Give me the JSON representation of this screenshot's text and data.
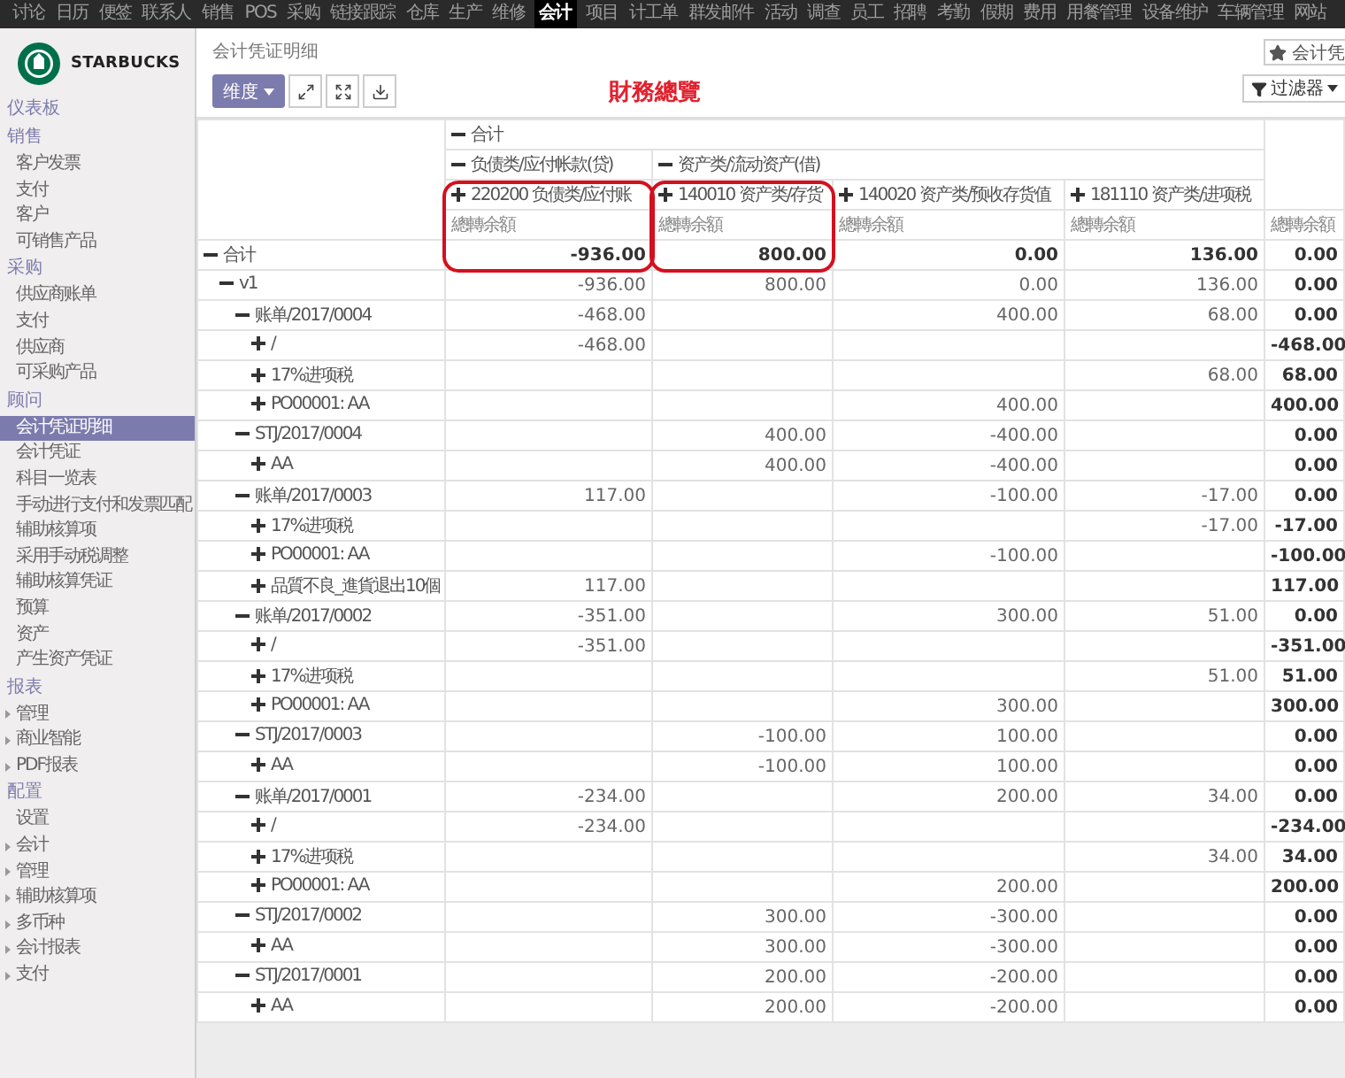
{
  "top_menu": [
    {
      "label": "讨论",
      "selected": false
    },
    {
      "label": "日历",
      "selected": false
    },
    {
      "label": "便签",
      "selected": false
    },
    {
      "label": "联系人",
      "selected": false
    },
    {
      "label": "销售",
      "selected": false
    },
    {
      "label": "POS",
      "selected": false
    },
    {
      "label": "采购",
      "selected": false
    },
    {
      "label": "链接跟踪",
      "selected": false
    },
    {
      "label": "仓库",
      "selected": false
    },
    {
      "label": "生产",
      "selected": false
    },
    {
      "label": "维修",
      "selected": false
    },
    {
      "label": "会计",
      "selected": true
    },
    {
      "label": "项目",
      "selected": false
    },
    {
      "label": "计工单",
      "selected": false
    },
    {
      "label": "群发邮件",
      "selected": false
    },
    {
      "label": "活动",
      "selected": false
    },
    {
      "label": "调查",
      "selected": false
    },
    {
      "label": "员工",
      "selected": false
    },
    {
      "label": "招聘",
      "selected": false
    },
    {
      "label": "考勤",
      "selected": false
    },
    {
      "label": "假期",
      "selected": false
    },
    {
      "label": "费用",
      "selected": false
    },
    {
      "label": "用餐管理",
      "selected": false
    },
    {
      "label": "设备维护",
      "selected": false
    },
    {
      "label": "车辆管理",
      "selected": false
    },
    {
      "label": "网站",
      "selected": false
    }
  ],
  "sidebar": {
    "logo_text": "STARBUCKS",
    "sections": [
      {
        "title": "仪表板"
      },
      {
        "title": "销售",
        "items": [
          {
            "label": "客户发票",
            "selected": false,
            "expandable": false
          },
          {
            "label": "支付",
            "selected": false,
            "expandable": false
          },
          {
            "label": "客户",
            "selected": false,
            "expandable": false
          },
          {
            "label": "可销售产品",
            "selected": false,
            "expandable": false
          }
        ]
      },
      {
        "title": "采购",
        "items": [
          {
            "label": "供应商账单",
            "selected": false,
            "expandable": false
          },
          {
            "label": "支付",
            "selected": false,
            "expandable": false
          },
          {
            "label": "供应商",
            "selected": false,
            "expandable": false
          },
          {
            "label": "可采购产品",
            "selected": false,
            "expandable": false
          }
        ]
      },
      {
        "title": "顾问",
        "items": [
          {
            "label": "会计凭证明细",
            "selected": true,
            "expandable": false
          },
          {
            "label": "会计凭证",
            "selected": false,
            "expandable": false
          },
          {
            "label": "科目一览表",
            "selected": false,
            "expandable": false
          },
          {
            "label": "手动进行支付和发票匹配",
            "selected": false,
            "expandable": false
          },
          {
            "label": "辅助核算项",
            "selected": false,
            "expandable": false
          },
          {
            "label": "采用手动税调整",
            "selected": false,
            "expandable": false
          },
          {
            "label": "辅助核算凭证",
            "selected": false,
            "expandable": false
          },
          {
            "label": "预算",
            "selected": false,
            "expandable": false
          },
          {
            "label": "资产",
            "selected": false,
            "expandable": false
          },
          {
            "label": "产生资产凭证",
            "selected": false,
            "expandable": false
          }
        ]
      },
      {
        "title": "报表",
        "items": [
          {
            "label": "管理",
            "selected": false,
            "expandable": true
          },
          {
            "label": "商业智能",
            "selected": false,
            "expandable": true
          },
          {
            "label": "PDF报表",
            "selected": false,
            "expandable": true
          }
        ]
      },
      {
        "title": "配置",
        "items": [
          {
            "label": "设置",
            "selected": false,
            "expandable": false
          },
          {
            "label": "会计",
            "selected": false,
            "expandable": true
          },
          {
            "label": "管理",
            "selected": false,
            "expandable": true
          },
          {
            "label": "辅助核算项",
            "selected": false,
            "expandable": true
          },
          {
            "label": "多币种",
            "selected": false,
            "expandable": true
          },
          {
            "label": "会计报表",
            "selected": false,
            "expandable": true
          },
          {
            "label": "支付",
            "selected": false,
            "expandable": true
          }
        ]
      }
    ]
  },
  "control_panel": {
    "breadcrumb": "会计凭证明细",
    "dimension_button": "维度",
    "annotation": "財務總覽",
    "favorite": "会计凭",
    "filter": "过滤器"
  },
  "pivot": {
    "total": {
      "label": "合计",
      "expanded": true
    },
    "groups": [
      {
        "label": "负债类/应付帐款(贷)",
        "expanded": true,
        "accounts": [
          {
            "label": "220200 负债类/应付账",
            "expanded": false,
            "circled": true
          }
        ]
      },
      {
        "label": "资产类/流动资产(借)",
        "expanded": true,
        "accounts": [
          {
            "label": "140010 资产类/存货",
            "expanded": false,
            "circled": true
          },
          {
            "label": "140020 资产类/预收存货值",
            "expanded": false,
            "circled": false
          },
          {
            "label": "181110 资产类/进项税",
            "expanded": false,
            "circled": false
          }
        ]
      }
    ],
    "measures": [
      "總轉余額",
      "總轉余額",
      "總轉余額",
      "總轉余額",
      "總轉余額"
    ],
    "rows": [
      {
        "label": "合计",
        "expanded": true,
        "values": {
          "col_1": "-936.00",
          "col_2": "800.00",
          "col_3": "0.00",
          "col_4": "136.00",
          "col_5": "0.00"
        },
        "children": [
          {
            "label": "v1",
            "expanded": true,
            "values": {
              "col_1": "-936.00",
              "col_2": "800.00",
              "col_3": "0.00",
              "col_4": "136.00",
              "col_5": "0.00"
            },
            "children": [
              {
                "label": "账单/2017/0004",
                "expanded": true,
                "values": {
                  "col_1": "-468.00",
                  "col_3": "400.00",
                  "col_4": "68.00",
                  "col_5": "0.00"
                },
                "children": [
                  {
                    "label": "/",
                    "expanded": false,
                    "values": {
                      "col_1": "-468.00",
                      "col_5": "-468.00"
                    }
                  },
                  {
                    "label": "17%进项税",
                    "expanded": false,
                    "values": {
                      "col_4": "68.00",
                      "col_5": "68.00"
                    }
                  },
                  {
                    "label": "PO00001: AA",
                    "expanded": false,
                    "values": {
                      "col_3": "400.00",
                      "col_5": "400.00"
                    }
                  }
                ]
              },
              {
                "label": "STJ/2017/0004",
                "expanded": true,
                "values": {
                  "col_2": "400.00",
                  "col_3": "-400.00",
                  "col_5": "0.00"
                },
                "children": [
                  {
                    "label": "AA",
                    "expanded": false,
                    "values": {
                      "col_2": "400.00",
                      "col_3": "-400.00",
                      "col_5": "0.00"
                    }
                  }
                ]
              },
              {
                "label": "账单/2017/0003",
                "expanded": true,
                "values": {
                  "col_1": "117.00",
                  "col_3": "-100.00",
                  "col_4": "-17.00",
                  "col_5": "0.00"
                },
                "children": [
                  {
                    "label": "17%进项税",
                    "expanded": false,
                    "values": {
                      "col_4": "-17.00",
                      "col_5": "-17.00"
                    }
                  },
                  {
                    "label": "PO00001: AA",
                    "expanded": false,
                    "values": {
                      "col_3": "-100.00",
                      "col_5": "-100.00"
                    }
                  },
                  {
                    "label": "品質不良_進貨退出10個",
                    "expanded": false,
                    "values": {
                      "col_1": "117.00",
                      "col_5": "117.00"
                    }
                  }
                ]
              },
              {
                "label": "账单/2017/0002",
                "expanded": true,
                "values": {
                  "col_1": "-351.00",
                  "col_3": "300.00",
                  "col_4": "51.00",
                  "col_5": "0.00"
                },
                "children": [
                  {
                    "label": "/",
                    "expanded": false,
                    "values": {
                      "col_1": "-351.00",
                      "col_5": "-351.00"
                    }
                  },
                  {
                    "label": "17%进项税",
                    "expanded": false,
                    "values": {
                      "col_4": "51.00",
                      "col_5": "51.00"
                    }
                  },
                  {
                    "label": "PO00001: AA",
                    "expanded": false,
                    "values": {
                      "col_3": "300.00",
                      "col_5": "300.00"
                    }
                  }
                ]
              },
              {
                "label": "STJ/2017/0003",
                "expanded": true,
                "values": {
                  "col_2": "-100.00",
                  "col_3": "100.00",
                  "col_5": "0.00"
                },
                "children": [
                  {
                    "label": "AA",
                    "expanded": false,
                    "values": {
                      "col_2": "-100.00",
                      "col_3": "100.00",
                      "col_5": "0.00"
                    }
                  }
                ]
              },
              {
                "label": "账单/2017/0001",
                "expanded": true,
                "values": {
                  "col_1": "-234.00",
                  "col_3": "200.00",
                  "col_4": "34.00",
                  "col_5": "0.00"
                },
                "children": [
                  {
                    "label": "/",
                    "expanded": false,
                    "values": {
                      "col_1": "-234.00",
                      "col_5": "-234.00"
                    }
                  },
                  {
                    "label": "17%进项税",
                    "expanded": false,
                    "values": {
                      "col_4": "34.00",
                      "col_5": "34.00"
                    }
                  },
                  {
                    "label": "PO00001: AA",
                    "expanded": false,
                    "values": {
                      "col_3": "200.00",
                      "col_5": "200.00"
                    }
                  }
                ]
              },
              {
                "label": "STJ/2017/0002",
                "expanded": true,
                "values": {
                  "col_2": "300.00",
                  "col_3": "-300.00",
                  "col_5": "0.00"
                },
                "children": [
                  {
                    "label": "AA",
                    "expanded": false,
                    "values": {
                      "col_2": "300.00",
                      "col_3": "-300.00",
                      "col_5": "0.00"
                    }
                  }
                ]
              },
              {
                "label": "STJ/2017/0001",
                "expanded": true,
                "values": {
                  "col_2": "200.00",
                  "col_3": "-200.00",
                  "col_5": "0.00"
                },
                "children": [
                  {
                    "label": "AA",
                    "expanded": false,
                    "values": {
                      "col_2": "200.00",
                      "col_3": "-200.00",
                      "col_5": "0.00"
                    }
                  }
                ]
              }
            ]
          }
        ]
      }
    ]
  }
}
